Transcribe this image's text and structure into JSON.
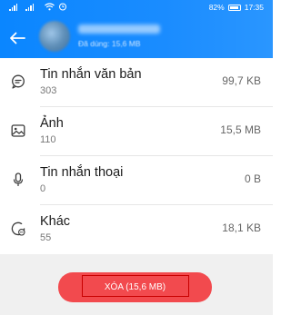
{
  "status_bar": {
    "battery": "82%",
    "time": "17:35"
  },
  "header": {
    "back_icon": "arrow-left-icon",
    "subtitle": "Đã dùng: 15,6 MB"
  },
  "categories": [
    {
      "icon": "chat-bubble-icon",
      "title": "Tin nhắn văn bản",
      "count": "303",
      "size": "99,7 KB"
    },
    {
      "icon": "image-icon",
      "title": "Ảnh",
      "count": "110",
      "size": "15,5 MB"
    },
    {
      "icon": "microphone-icon",
      "title": "Tin nhắn thoại",
      "count": "0",
      "size": "0 B"
    },
    {
      "icon": "other-icon",
      "title": "Khác",
      "count": "55",
      "size": "18,1 KB"
    }
  ],
  "footer": {
    "delete_label": "XÓA (15,6 MB)"
  },
  "colors": {
    "header": "#0a86ff",
    "delete_button": "#f24a4e",
    "footer_bg": "#f0f0f0"
  }
}
